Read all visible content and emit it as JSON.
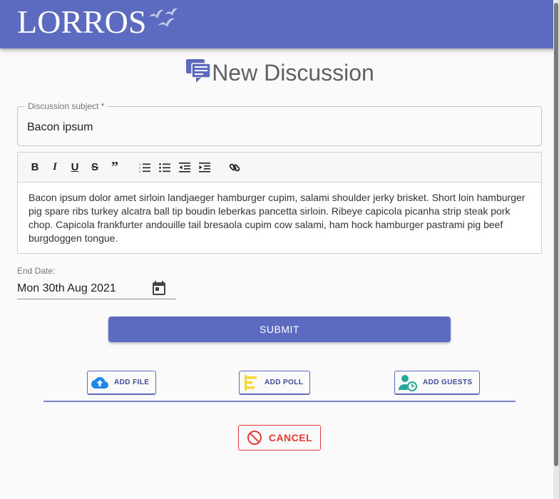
{
  "app": {
    "logo_text": "LORROS",
    "brand_color": "#5c6bc0"
  },
  "page": {
    "title": "New Discussion"
  },
  "subject": {
    "label": "Discussion subject *",
    "value": "Bacon ipsum"
  },
  "editor": {
    "toolbar": [
      "bold-icon",
      "italic-icon",
      "underline-icon",
      "strikethrough-icon",
      "quote-icon",
      "numbered-list-icon",
      "bulleted-list-icon",
      "outdent-icon",
      "indent-icon",
      "link-icon"
    ],
    "body": "Bacon ipsum dolor amet sirloin landjaeger hamburger cupim, salami shoulder jerky brisket. Short loin hamburger pig spare ribs turkey alcatra ball tip boudin leberkas pancetta sirloin. Ribeye capicola picanha strip steak pork chop. Capicola frankfurter andouille tail bresaola cupim cow salami, ham hock hamburger pastrami pig beef burgdoggen tongue."
  },
  "end_date": {
    "label": "End Date:",
    "value": "Mon 30th Aug 2021"
  },
  "buttons": {
    "submit": "SUBMIT",
    "add_file": "ADD FILE",
    "add_poll": "ADD POLL",
    "add_guests": "ADD GUESTS",
    "cancel": "CANCEL"
  },
  "colors": {
    "accent": "#5c6bc0",
    "danger": "#e53935",
    "file_icon": "#1e88e5",
    "poll_icon": "#fdd835",
    "guests_icon": "#26a69a"
  }
}
